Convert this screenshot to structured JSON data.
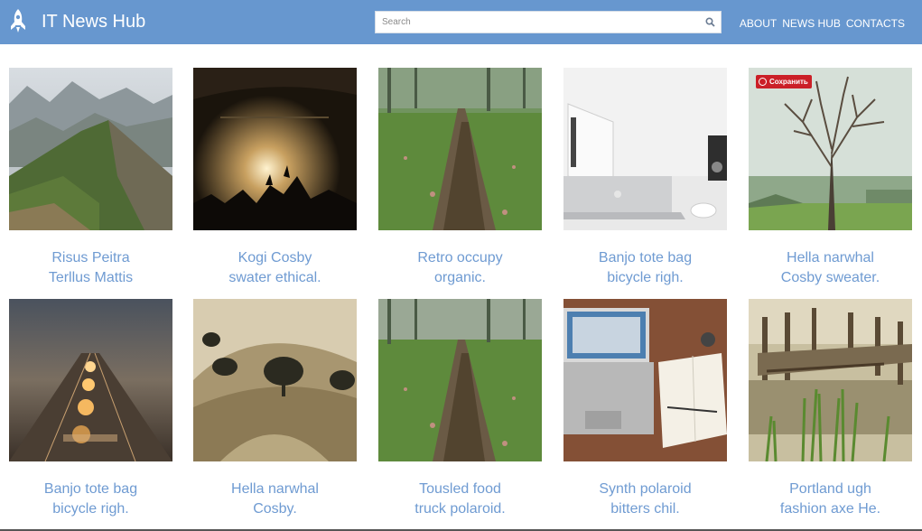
{
  "header": {
    "brand": "IT News Hub",
    "logo_icon": "rocket-icon",
    "background": "#6797cf"
  },
  "search": {
    "placeholder": "Search",
    "value": "",
    "icon": "search-icon"
  },
  "nav": {
    "items": [
      "ABOUT",
      "NEWS HUB",
      "CONTACTS"
    ]
  },
  "pin_button": {
    "label": "Сохранить"
  },
  "cards": [
    {
      "line1": "Risus Peitra",
      "line2": "Terllus Mattis",
      "image": "mountain-image"
    },
    {
      "line1": "Kogi Cosby",
      "line2": "swater ethical.",
      "image": "concert-image"
    },
    {
      "line1": "Retro occupy",
      "line2": "organic.",
      "image": "forest-path-image"
    },
    {
      "line1": "Banjo tote bag",
      "line2": "bicycle righ.",
      "image": "laptop-desk-image"
    },
    {
      "line1": "Hella narwhal",
      "line2": "Cosby sweater.",
      "image": "tree-image"
    },
    {
      "line1": "Banjo tote bag",
      "line2": "bicycle righ.",
      "image": "night-road-image"
    },
    {
      "line1": "Hella narwhal",
      "line2": "Cosby.",
      "image": "hill-trees-image"
    },
    {
      "line1": "Tousled food",
      "line2": "truck polaroid.",
      "image": "forest-path-image"
    },
    {
      "line1": "Synth polaroid",
      "line2": "bitters chil.",
      "image": "laptop-notebook-image"
    },
    {
      "line1": "Portland ugh",
      "line2": "fashion axe He.",
      "image": "dock-image"
    }
  ],
  "colors": {
    "caption": "#6f9bd2",
    "accent": "#6797cf",
    "pin": "#cb1f27"
  }
}
